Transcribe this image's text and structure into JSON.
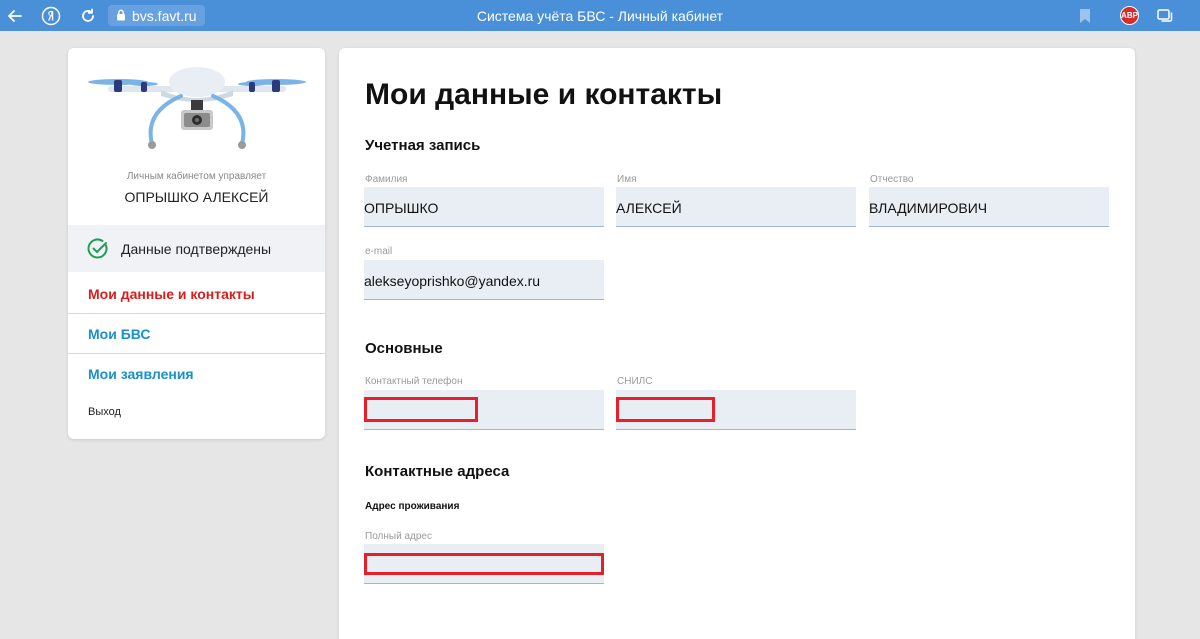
{
  "browser": {
    "url": "bvs.favt.ru",
    "window_title": "Система учёта БВС - Личный кабинет",
    "abp_label": "ABP"
  },
  "sidebar": {
    "managed_caption": "Личным кабинетом управляет",
    "manager_name": "ОПРЫШКО АЛЕКСЕЙ",
    "verified_label": "Данные подтверждены",
    "nav": [
      {
        "label": "Мои данные и контакты"
      },
      {
        "label": "Мои БВС"
      },
      {
        "label": "Мои заявления"
      }
    ],
    "logout_label": "Выход"
  },
  "main": {
    "title": "Мои данные и контакты",
    "account": {
      "title": "Учетная запись",
      "surname_label": "Фамилия",
      "surname": "ОПРЫШКО",
      "name_label": "Имя",
      "name": "АЛЕКСЕЙ",
      "patronymic_label": "Отчество",
      "patronymic": "ВЛАДИМИРОВИЧ",
      "email_label": "e-mail",
      "email": "alekseyoprishko@yandex.ru"
    },
    "basic": {
      "title": "Основные",
      "phone_label": "Контактный телефон",
      "snils_label": "СНИЛС"
    },
    "addresses": {
      "title": "Контактные адреса",
      "residence_title": "Адрес проживания",
      "full_address_label": "Полный адрес"
    }
  },
  "colors": {
    "browser_bar": "#4a90d9",
    "nav_active": "#d91c1c",
    "nav_link": "#1a8fcc",
    "field_bg": "#e9eef5",
    "redaction": "#e8202a"
  }
}
